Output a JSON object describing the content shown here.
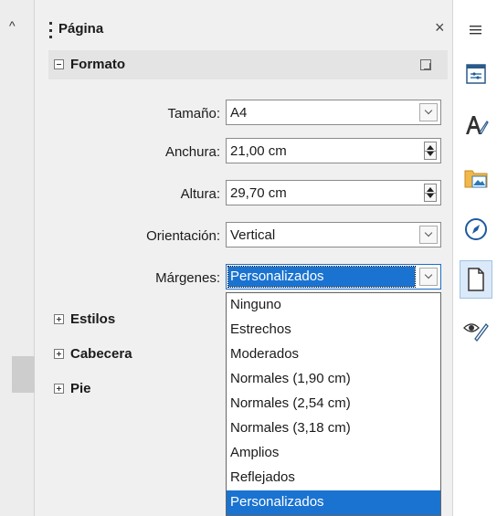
{
  "panel": {
    "title": "Página",
    "close_glyph": "×"
  },
  "sections": {
    "formato": "Formato",
    "estilos": "Estilos",
    "cabecera": "Cabecera",
    "pie": "Pie"
  },
  "form": {
    "size_label": "Tamaño:",
    "size_value": "A4",
    "width_label": "Anchura:",
    "width_value": "21,00 cm",
    "height_label": "Altura:",
    "height_value": "29,70 cm",
    "orientation_label": "Orientación:",
    "orientation_value": "Vertical",
    "margins_label": "Márgenes:",
    "margins_value": "Personalizados"
  },
  "margins_options": [
    "Ninguno",
    "Estrechos",
    "Moderados",
    "Normales (1,90 cm)",
    "Normales (2,54 cm)",
    "Normales (3,18 cm)",
    "Amplios",
    "Reflejados",
    "Personalizados"
  ],
  "margins_selected_index": 8,
  "sidebar_icons": [
    "menu-icon",
    "properties-icon",
    "styles-icon",
    "gallery-icon",
    "navigator-icon",
    "page-icon",
    "style-inspector-icon"
  ],
  "colors": {
    "accent": "#1a73d1",
    "panel_bg": "#f0f0f0",
    "section_bg": "#e4e4e4"
  }
}
